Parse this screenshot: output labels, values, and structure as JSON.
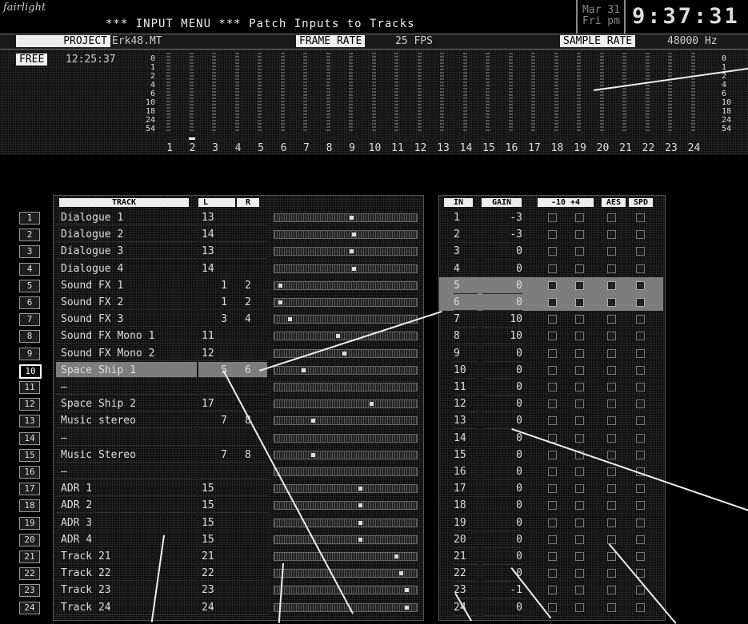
{
  "header": {
    "logo": "fairlight",
    "title": "*** INPUT MENU ***   Patch Inputs to Tracks",
    "date_line1": "Mar 31",
    "date_line2": "Fri pm",
    "clock": "9:37:31"
  },
  "infobar": {
    "project_label": "PROJECT",
    "project_value": "Erk48.MT",
    "frame_rate_label": "FRAME RATE",
    "frame_rate_value": "25 FPS",
    "sample_rate_label": "SAMPLE RATE",
    "sample_rate_value": "48000 Hz"
  },
  "meter": {
    "free_label": "FREE",
    "free_value": "12:25:37",
    "scale": [
      "0",
      "1",
      "2",
      "4",
      "6",
      "10",
      "18",
      "24",
      "54"
    ],
    "channels": [
      "1",
      "2",
      "3",
      "4",
      "5",
      "6",
      "7",
      "8",
      "9",
      "10",
      "11",
      "12",
      "13",
      "14",
      "15",
      "16",
      "17",
      "18",
      "19",
      "20",
      "21",
      "22",
      "23",
      "24"
    ],
    "active_channel_index": 1
  },
  "track_table": {
    "headers": {
      "track": "TRACK",
      "l": "L",
      "r": "R"
    },
    "rows": [
      {
        "num": "1",
        "name": "Dialogue 1",
        "l": "13",
        "r": "",
        "pan": 0.55
      },
      {
        "num": "2",
        "name": "Dialogue 2",
        "l": "14",
        "r": "",
        "pan": 0.57
      },
      {
        "num": "3",
        "name": "Dialogue 3",
        "l": "13",
        "r": "",
        "pan": 0.55
      },
      {
        "num": "4",
        "name": "Dialogue 4",
        "l": "14",
        "r": "",
        "pan": 0.57
      },
      {
        "num": "5",
        "name": "Sound FX 1",
        "l": "1",
        "r": "2",
        "pan": 0.03
      },
      {
        "num": "6",
        "name": "Sound FX 2",
        "l": "1",
        "r": "2",
        "pan": 0.03
      },
      {
        "num": "7",
        "name": "Sound FX 3",
        "l": "3",
        "r": "4",
        "pan": 0.1
      },
      {
        "num": "8",
        "name": "Sound FX Mono 1",
        "l": "11",
        "r": "",
        "pan": 0.45
      },
      {
        "num": "9",
        "name": "Sound FX Mono 2",
        "l": "12",
        "r": "",
        "pan": 0.5
      },
      {
        "num": "10",
        "name": "Space Ship 1",
        "l": "5",
        "r": "6",
        "pan": 0.2
      },
      {
        "num": "11",
        "name": "–",
        "l": "",
        "r": "",
        "pan": -1
      },
      {
        "num": "12",
        "name": "Space Ship 2",
        "l": "17",
        "r": "",
        "pan": 0.7
      },
      {
        "num": "13",
        "name": "Music stereo",
        "l": "7",
        "r": "8",
        "pan": 0.27
      },
      {
        "num": "14",
        "name": "–",
        "l": "",
        "r": "",
        "pan": -1
      },
      {
        "num": "15",
        "name": "Music Stereo",
        "l": "7",
        "r": "8",
        "pan": 0.27
      },
      {
        "num": "16",
        "name": "–",
        "l": "",
        "r": "",
        "pan": -1
      },
      {
        "num": "17",
        "name": "ADR 1",
        "l": "15",
        "r": "",
        "pan": 0.62
      },
      {
        "num": "18",
        "name": "ADR 2",
        "l": "15",
        "r": "",
        "pan": 0.62
      },
      {
        "num": "19",
        "name": "ADR 3",
        "l": "15",
        "r": "",
        "pan": 0.62
      },
      {
        "num": "20",
        "name": "ADR 4",
        "l": "15",
        "r": "",
        "pan": 0.62
      },
      {
        "num": "21",
        "name": "Track 21",
        "l": "21",
        "r": "",
        "pan": 0.88
      },
      {
        "num": "22",
        "name": "Track 22",
        "l": "22",
        "r": "",
        "pan": 0.92
      },
      {
        "num": "23",
        "name": "Track 23",
        "l": "23",
        "r": "",
        "pan": 0.96
      },
      {
        "num": "24",
        "name": "Track 24",
        "l": "24",
        "r": "",
        "pan": 0.96
      }
    ],
    "selected_row": "10"
  },
  "input_table": {
    "headers": {
      "in": "IN",
      "gain": "GAIN",
      "level": "-10 +4",
      "aes": "AES",
      "spd": "SPD"
    },
    "rows": [
      {
        "in": "1",
        "gain": "-3"
      },
      {
        "in": "2",
        "gain": "-3"
      },
      {
        "in": "3",
        "gain": "0"
      },
      {
        "in": "4",
        "gain": "0"
      },
      {
        "in": "5",
        "gain": "0"
      },
      {
        "in": "6",
        "gain": "0"
      },
      {
        "in": "7",
        "gain": "10"
      },
      {
        "in": "8",
        "gain": "10"
      },
      {
        "in": "9",
        "gain": "0"
      },
      {
        "in": "10",
        "gain": "0"
      },
      {
        "in": "11",
        "gain": "0"
      },
      {
        "in": "12",
        "gain": "0"
      },
      {
        "in": "13",
        "gain": "0"
      },
      {
        "in": "14",
        "gain": "0"
      },
      {
        "in": "15",
        "gain": "0"
      },
      {
        "in": "16",
        "gain": "0"
      },
      {
        "in": "17",
        "gain": "0"
      },
      {
        "in": "18",
        "gain": "0"
      },
      {
        "in": "19",
        "gain": "0"
      },
      {
        "in": "20",
        "gain": "0"
      },
      {
        "in": "21",
        "gain": "0"
      },
      {
        "in": "22",
        "gain": "0"
      },
      {
        "in": "23",
        "gain": "-1"
      },
      {
        "in": "24",
        "gain": "0"
      }
    ],
    "highlighted_inputs": [
      "5",
      "6"
    ]
  },
  "colors": {
    "background": "#000000",
    "highlight": "#7d7d7d",
    "text": "#dddddd"
  }
}
